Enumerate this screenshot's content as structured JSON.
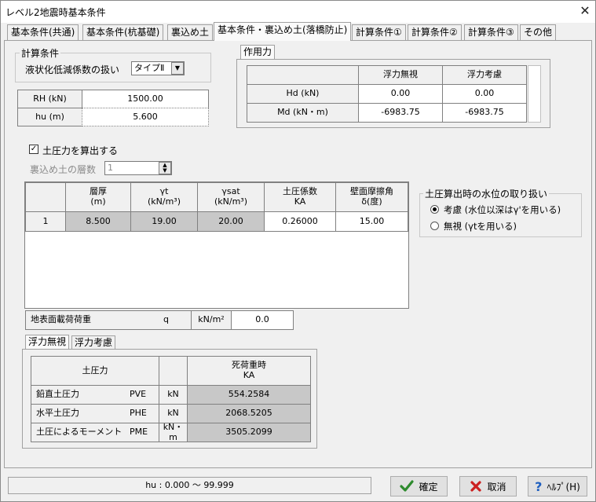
{
  "window": {
    "title": "レベル2地震時基本条件",
    "close_glyph": "✕"
  },
  "tabs": [
    "基本条件(共通)",
    "基本条件(杭基礎)",
    "裏込め土",
    "基本条件・裏込め土(落橋防止)",
    "計算条件①",
    "計算条件②",
    "計算条件③",
    "その他"
  ],
  "calc_conditions": {
    "legend": "計算条件",
    "liquefaction_label": "液状化低減係数の扱い",
    "liquefaction_value": "タイプⅡ"
  },
  "rh_table": {
    "rows": [
      {
        "label": "RH (kN)",
        "value": "1500.00"
      },
      {
        "label": "hu (m)",
        "value": "5.600"
      }
    ]
  },
  "force_panel": {
    "tab": "作用力",
    "headers": [
      "",
      "浮力無視",
      "浮力考慮"
    ],
    "rows": [
      {
        "label": "Hd (kN)",
        "v1": "0.00",
        "v2": "0.00"
      },
      {
        "label": "Md (kN・m)",
        "v1": "-6983.75",
        "v2": "-6983.75"
      }
    ]
  },
  "earth_pressure_check": {
    "label": "土圧力を算出する",
    "checked": true
  },
  "layer_count": {
    "label": "裏込め土の層数",
    "value": "1"
  },
  "layer_table": {
    "headers": [
      {
        "line1": "",
        "line2": ""
      },
      {
        "line1": "層厚",
        "line2": "(m)"
      },
      {
        "line1": "γt",
        "line2": "(kN/m³)"
      },
      {
        "line1": "γsat",
        "line2": "(kN/m³)"
      },
      {
        "line1": "土圧係数",
        "line2": "KA"
      },
      {
        "line1": "壁面摩擦角",
        "line2": "δ(度)"
      }
    ],
    "rows": [
      {
        "index": "1",
        "thickness": "8.500",
        "gamma_t": "19.00",
        "gamma_sat": "20.00",
        "ka": "0.26000",
        "delta": "15.00"
      }
    ]
  },
  "surcharge": {
    "label": "地表面載荷荷重",
    "symbol": "q",
    "unit": "kN/m²",
    "value": "0.0"
  },
  "water_level": {
    "legend": "土圧算出時の水位の取り扱い",
    "options": [
      {
        "label": "考慮 (水位以深はγ'を用いる)",
        "selected": true
      },
      {
        "label": "無視 (γtを用いる)",
        "selected": false
      }
    ]
  },
  "result_tabs": [
    "浮力無視",
    "浮力考慮"
  ],
  "result_table": {
    "header_label": "土圧力",
    "header_col": {
      "line1": "死荷重時",
      "line2": "KA"
    },
    "rows": [
      {
        "name": "鉛直土圧力",
        "sym": "PVE",
        "unit": "kN",
        "value": "554.2584"
      },
      {
        "name": "水平土圧力",
        "sym": "PHE",
        "unit": "kN",
        "value": "2068.5205"
      },
      {
        "name": "土圧によるモーメント",
        "sym": "PME",
        "unit": "kN・m",
        "value": "3505.2099"
      }
    ]
  },
  "status_bar": {
    "text": "hu : 0.000 〜 99.999"
  },
  "buttons": {
    "ok": {
      "label": "確定",
      "icon": "check-icon"
    },
    "cancel": {
      "label": "取消",
      "icon": "x-icon"
    },
    "help": {
      "label": "ﾍﾙﾌﾟ(H)",
      "icon": "question-icon"
    }
  },
  "colors": {
    "gray_cell": "#c8c8c8",
    "ok_green": "#2e8b2e",
    "cancel_red": "#cc1f1f",
    "help_blue": "#1f5fbf"
  }
}
